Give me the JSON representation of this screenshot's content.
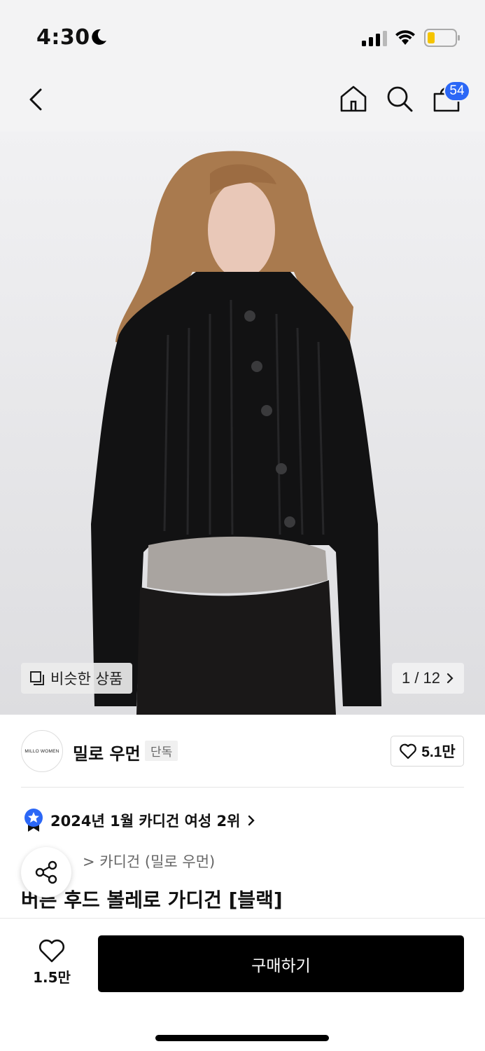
{
  "status_bar": {
    "time": "4:30"
  },
  "nav": {
    "cart_count": "54"
  },
  "image": {
    "similar_label": "비슷한 상품",
    "page_counter": "1 / 12"
  },
  "brand": {
    "logo_text": "MILLO WOMEN",
    "name": "밀로 우먼",
    "tag": "단독",
    "likes": "5.1만"
  },
  "ranking": {
    "text": "2024년 1월 카디건 여성 2위"
  },
  "category": {
    "text": "> 카디건 (밀로 우먼)"
  },
  "product": {
    "title": "버튼 후드 볼레로 가디건 [블랙]"
  },
  "bottom": {
    "wish_count": "1.5만",
    "buy_label": "구매하기"
  },
  "colors": {
    "accent": "#2b67f6",
    "buy_button": "#000000"
  }
}
